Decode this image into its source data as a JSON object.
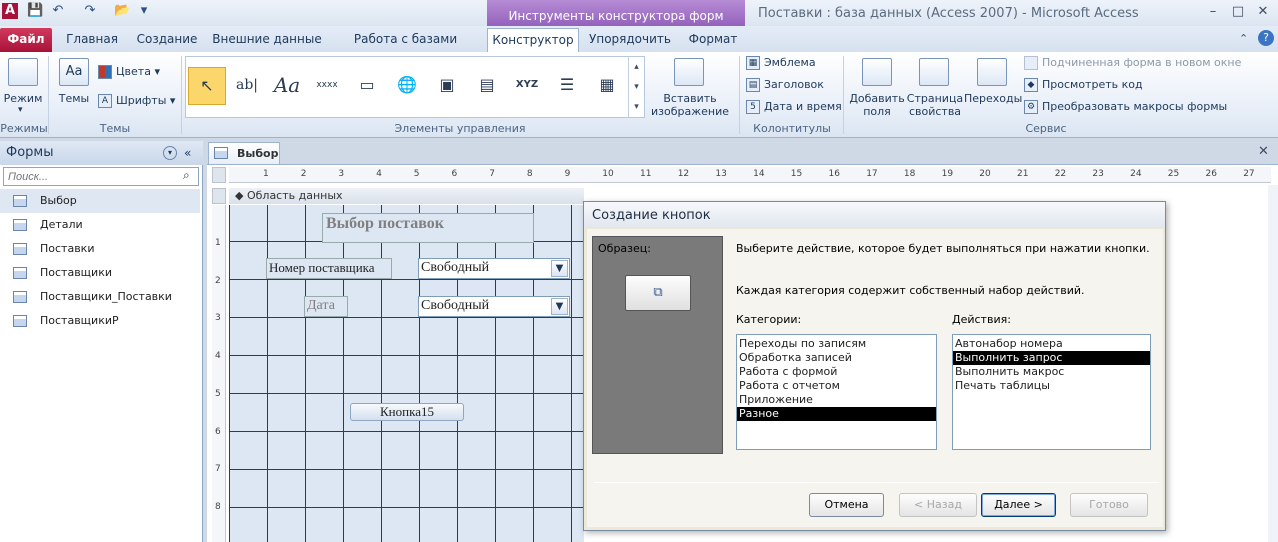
{
  "window": {
    "title": "Поставки : база данных (Access 2007)  -  Microsoft Access",
    "context_tab_group": "Инструменты конструктора форм",
    "min": "–",
    "max": "□",
    "close": "✕"
  },
  "tabs": [
    "Файл",
    "Главная",
    "Создание",
    "Внешние данные",
    "Работа с базами данных",
    "Конструктор",
    "Упорядочить",
    "Формат"
  ],
  "ribbon": {
    "view": {
      "label": "Режим",
      "group": "Режимы"
    },
    "themes": {
      "themes": "Темы",
      "colors": "Цвета",
      "fonts": "Шрифты",
      "group": "Темы"
    },
    "controls": {
      "group": "Элементы управления",
      "insert_image": "Вставить",
      "insert_image2": "изображение"
    },
    "header_footer": {
      "logo": "Эмблема",
      "title": "Заголовок",
      "datetime": "Дата и время",
      "group": "Колонтитулы"
    },
    "tools": {
      "add_fields": "Добавить",
      "add_fields2": "поля",
      "property_sheet": "Страница",
      "property_sheet2": "свойства",
      "tab_order": "Переходы",
      "subform": "Подчиненная форма в новом окне",
      "view_code": "Просмотреть код",
      "convert_macros": "Преобразовать макросы формы",
      "group": "Сервис"
    }
  },
  "nav": {
    "header": "Формы",
    "search_placeholder": "Поиск...",
    "items": [
      "Выбор",
      "Детали",
      "Поставки",
      "Поставщики",
      "Поставщики_Поставки",
      "ПоставщикиР"
    ]
  },
  "document": {
    "tab": "Выбор",
    "section": "Область данных",
    "ruler_marks": [
      "1",
      "2",
      "3",
      "4",
      "5",
      "6",
      "7",
      "8",
      "9",
      "10",
      "11",
      "12",
      "13",
      "14",
      "15",
      "16",
      "17",
      "18",
      "19",
      "20",
      "21",
      "22",
      "23",
      "24",
      "25",
      "26",
      "27"
    ],
    "vruler_marks": [
      "1",
      "2",
      "3",
      "4",
      "5",
      "6",
      "7",
      "8"
    ],
    "form": {
      "title": "Выбор поставок",
      "supplier_label": "Номер поставщика",
      "supplier_value": "Свободный",
      "date_label": "Дата",
      "date_value": "Свободный",
      "button": "Кнопка15"
    }
  },
  "dialog": {
    "title": "Создание кнопок",
    "sample": "Образец:",
    "prompt": "Выберите действие, которое будет выполняться при нажатии кнопки.",
    "info": "Каждая категория содержит собственный набор действий.",
    "categories_label": "Категории:",
    "actions_label": "Действия:",
    "categories": [
      "Переходы по записям",
      "Обработка записей",
      "Работа с формой",
      "Работа с отчетом",
      "Приложение",
      "Разное"
    ],
    "selected_category": 5,
    "actions": [
      "Автонабор номера",
      "Выполнить запрос",
      "Выполнить макрос",
      "Печать таблицы"
    ],
    "selected_action": 1,
    "buttons": {
      "cancel": "Отмена",
      "back": "< Назад",
      "next": "Далее >",
      "finish": "Готово"
    }
  }
}
